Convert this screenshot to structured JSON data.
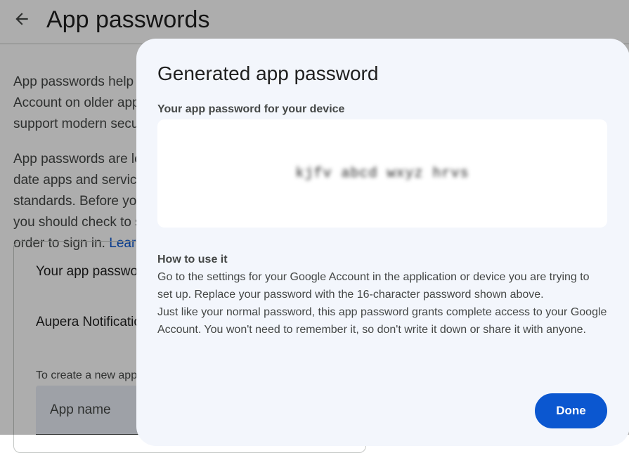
{
  "page": {
    "title": "App passwords",
    "intro_para1": "App passwords help you sign in to your Google Account on older apps and services that don’t support modern security standards.",
    "intro_para2_prefix": "App passwords are less secure than using up-to-date apps and services that use modern security standards. Before you create an app password, you should check to see if your app needs this in order to sign in.",
    "learn_more": "Learn more"
  },
  "card": {
    "title": "Your app passwords",
    "existing_app": "Aupera Notifications",
    "create_hint": "To create a new app specific password, type a name for it below...",
    "input_placeholder": "App name"
  },
  "dialog": {
    "title": "Generated app password",
    "password_label": "Your app password for your device",
    "password_value": "kjfv abcd wxyz hrvs",
    "howto_title": "How to use it",
    "howto_para1": "Go to the settings for your Google Account in the application or device you are trying to set up. Replace your password with the 16-character password shown above.",
    "howto_para2": "Just like your normal password, this app password grants complete access to your Google Account. You won't need to remember it, so don't write it down or share it with anyone.",
    "done_label": "Done"
  },
  "icons": {
    "back": "arrow-back-icon"
  },
  "colors": {
    "accent": "#0b57d0",
    "dialog_bg": "#f3f6fc",
    "scrim": "rgba(0,0,0,0.32)"
  }
}
